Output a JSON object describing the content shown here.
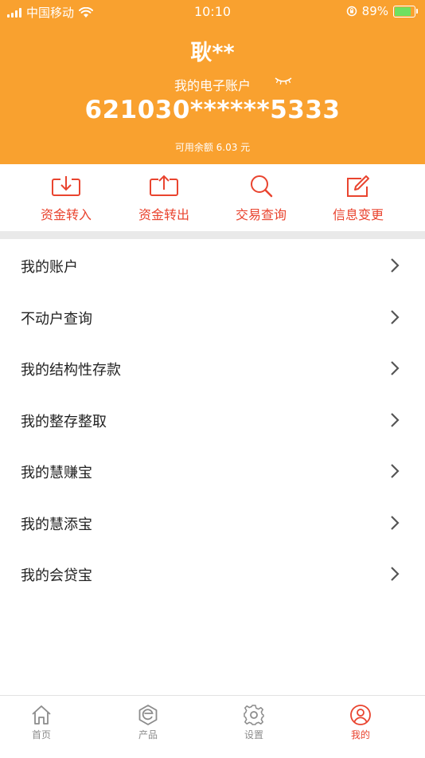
{
  "status_bar": {
    "carrier": "中国移动",
    "time": "10:10",
    "battery": "89%"
  },
  "account": {
    "name": "耿**",
    "account_label": "我的电子账户",
    "account_number": "621030******5333",
    "balance_text": "可用余额 6.03 元"
  },
  "quick_actions": [
    {
      "label": "资金转入",
      "icon": "download-tray-icon"
    },
    {
      "label": "资金转出",
      "icon": "upload-tray-icon"
    },
    {
      "label": "交易查询",
      "icon": "search-icon"
    },
    {
      "label": "信息变更",
      "icon": "edit-icon"
    }
  ],
  "menu": [
    {
      "label": "我的账户"
    },
    {
      "label": "不动户查询"
    },
    {
      "label": "我的结构性存款"
    },
    {
      "label": "我的整存整取"
    },
    {
      "label": "我的慧赚宝"
    },
    {
      "label": "我的慧添宝"
    },
    {
      "label": "我的会贷宝"
    }
  ],
  "tabs": [
    {
      "label": "首页",
      "icon": "home-icon"
    },
    {
      "label": "产品",
      "icon": "product-icon"
    },
    {
      "label": "设置",
      "icon": "gear-icon"
    },
    {
      "label": "我的",
      "icon": "user-icon",
      "active": true
    }
  ],
  "colors": {
    "header_bg": "#F9A12F",
    "accent": "#E9442F",
    "divider": "#E9E9E9"
  }
}
